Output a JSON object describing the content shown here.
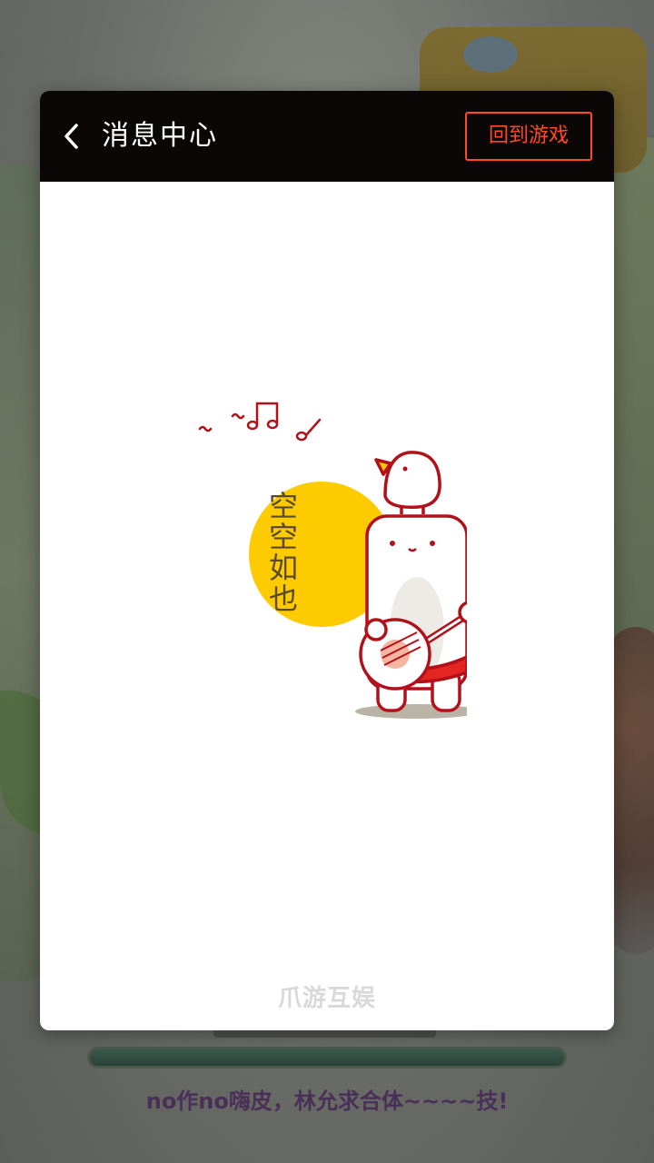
{
  "header": {
    "title": "消息中心",
    "return_label": "回到游戏"
  },
  "empty_state": {
    "text": "空空如也"
  },
  "footer": {
    "brand": "爪游互娱"
  },
  "background": {
    "caption": "no作no嗨皮，林允求合体~~~~技!"
  },
  "colors": {
    "header_bg": "#0b0707",
    "accent": "#ff4a22",
    "sun_yellow": "#fdcb00",
    "outline_red": "#b3111a"
  },
  "icons": {
    "back": "chevron-left-icon",
    "mascot": "mascot-illustration"
  }
}
